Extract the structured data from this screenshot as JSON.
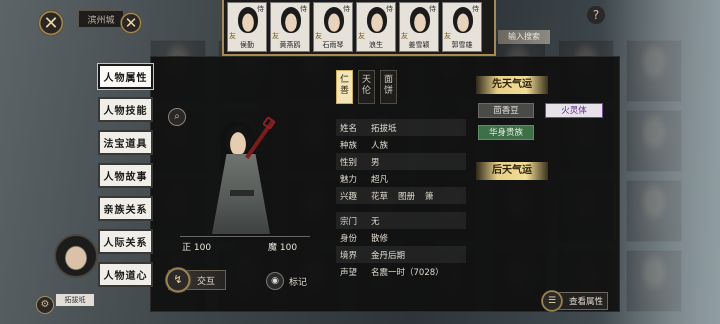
{
  "header": {
    "close_symbol": "✕",
    "close_symbol_2": "✕",
    "location_label": "滨州城",
    "ghost_tag": "输入搜索",
    "corner_symbol": "?"
  },
  "top_strip": [
    {
      "name": "侯勤",
      "tag": "侍",
      "seal": "友"
    },
    {
      "name": "黄燕鸥",
      "tag": "侍",
      "seal": "友"
    },
    {
      "name": "石雨琴",
      "tag": "侍",
      "seal": "友"
    },
    {
      "name": "浪生",
      "tag": "侍",
      "seal": "友"
    },
    {
      "name": "姜雪颖",
      "tag": "侍",
      "seal": "友"
    },
    {
      "name": "郭雪雄",
      "tag": "侍",
      "seal": "友"
    }
  ],
  "side_tabs": [
    "人物属性",
    "人物技能",
    "法宝道具",
    "人物故事",
    "亲族关系",
    "人际关系",
    "人物道心"
  ],
  "active_side_tab": 0,
  "search_icon": "⌕",
  "stats": {
    "zheng": "正 100",
    "mo": "魔 100"
  },
  "actions": {
    "interact_icon": "↯",
    "interact_label": "交互",
    "mark_icon": "◉",
    "mark_label": "标记"
  },
  "vertical_tabs": [
    {
      "label": "仁\n善",
      "active": true
    },
    {
      "label": "天\n伦",
      "active": false
    },
    {
      "label": "面\n饼",
      "active": false
    }
  ],
  "info": [
    {
      "key": "姓名",
      "value": "拓拔坻"
    },
    {
      "key": "种族",
      "value": "人族"
    },
    {
      "key": "性别",
      "value": "男"
    },
    {
      "key": "魅力",
      "value": "超凡"
    },
    {
      "key": "兴趣",
      "value": [
        "花草",
        "图册",
        "箫"
      ]
    }
  ],
  "info2": [
    {
      "key": "宗门",
      "value": "无"
    },
    {
      "key": "身份",
      "value": "散修"
    },
    {
      "key": "境界",
      "value": "金丹后期"
    },
    {
      "key": "声望",
      "value": "名震一时（7028）"
    }
  ],
  "fortune": {
    "innate_title": "先天气运",
    "innate_traits": [
      {
        "label": "茴香豆",
        "style": "grey"
      },
      {
        "label": "火灵体",
        "style": "purple"
      },
      {
        "label": "华身贵族",
        "style": "green"
      }
    ],
    "acquired_title": "后天气运"
  },
  "view_button": {
    "icon": "☰",
    "label": "查看属性"
  },
  "bottom_left": {
    "gear_icon": "⚙",
    "avatar_tag": "拓拔坻"
  },
  "colors": {
    "gold": "#e8cf87",
    "panel": "#101010",
    "purple_trait": "#5c2c8a",
    "green_trait": "#3f6f46"
  }
}
